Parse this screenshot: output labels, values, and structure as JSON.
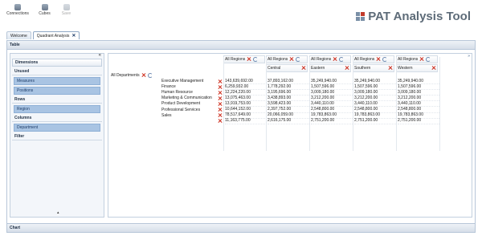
{
  "toolbar": {
    "buttons": [
      {
        "label": "Connections",
        "icon": "connections-icon",
        "enabled": true
      },
      {
        "label": "Cubes",
        "icon": "cubes-icon",
        "enabled": true
      },
      {
        "label": "Save",
        "icon": "save-icon",
        "enabled": false
      }
    ]
  },
  "brand": {
    "title": "PAT Analysis Tool"
  },
  "tabs": [
    {
      "label": "Welcome",
      "closable": false
    },
    {
      "label": "Quadrant Analysis",
      "closable": true,
      "active": true
    }
  ],
  "panels": {
    "table_label": "Table",
    "chart_label": "Chart"
  },
  "dimensions": {
    "title": "Dimensions",
    "collapse_glyph": "«",
    "expand_glyph": "»",
    "unused_label": "Unused",
    "unused_items": [
      "Measures",
      "Positions"
    ],
    "rows_label": "Rows",
    "rows_items": [
      "Region"
    ],
    "columns_label": "Columns",
    "columns_items": [
      "Department"
    ],
    "filter_label": "Filter",
    "bottom_glyph": "▴"
  },
  "pivot": {
    "row_dimension": "All Departments",
    "col_top": "All Regions",
    "columns": [
      "All Regions",
      "Central",
      "Eastern",
      "Southern",
      "Western"
    ],
    "rows": [
      {
        "label": "Executive Management",
        "values": [
          "143,639,692.00",
          "37,893,162.00",
          "35,249,940.00",
          "35,249,940.00",
          "35,249,940.00"
        ]
      },
      {
        "label": "Finance",
        "values": [
          "6,259,932.00",
          "1,778,292.00",
          "1,507,596.00",
          "1,507,596.00",
          "1,507,596.00"
        ]
      },
      {
        "label": "Human Resource",
        "values": [
          "12,224,220.00",
          "3,195,696.00",
          "3,009,180.00",
          "3,009,180.00",
          "3,009,180.00"
        ]
      },
      {
        "label": "Marketing & Communication",
        "values": [
          "13,075,463.00",
          "3,438,893.00",
          "3,212,200.00",
          "3,212,200.00",
          "3,212,200.00"
        ]
      },
      {
        "label": "Product Development",
        "values": [
          "13,919,753.00",
          "3,598,423.00",
          "3,440,110.00",
          "3,440,110.00",
          "3,440,110.00"
        ]
      },
      {
        "label": "Professional Services",
        "values": [
          "10,644,152.00",
          "2,397,752.00",
          "2,548,800.00",
          "2,548,800.00",
          "2,548,800.00"
        ]
      },
      {
        "label": "Sales",
        "values": [
          "78,517,649.00",
          "20,066,059.00",
          "19,783,863.00",
          "19,783,863.00",
          "19,783,863.00"
        ]
      },
      {
        "label": "",
        "values": [
          "11,163,775.00",
          "2,616,175.00",
          "2,751,200.00",
          "2,751,200.00",
          "2,751,200.00"
        ]
      }
    ]
  }
}
